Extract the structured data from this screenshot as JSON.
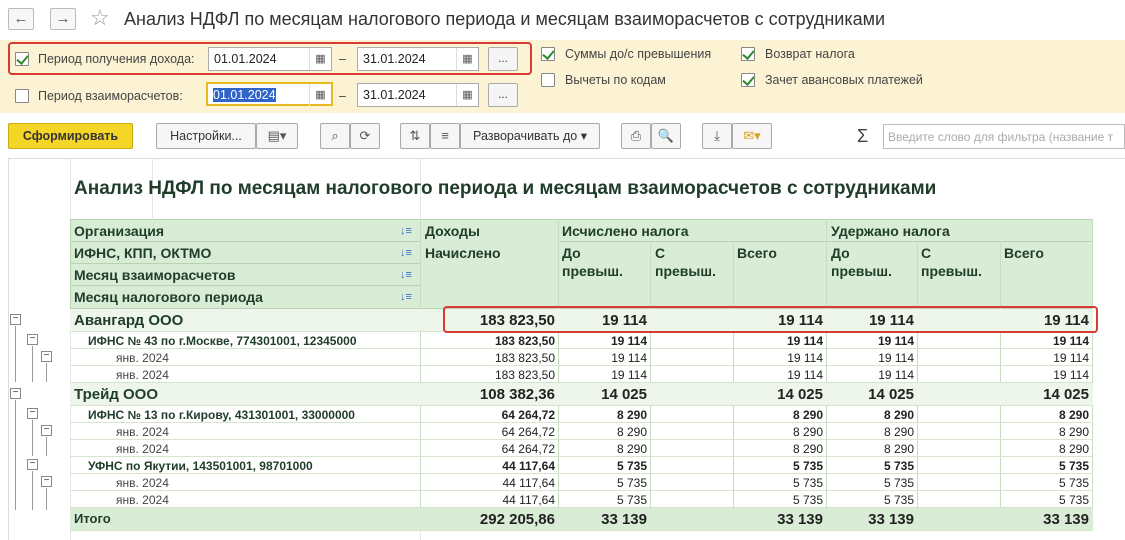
{
  "window": {
    "title": "Анализ НДФЛ по месяцам налогового периода и месяцам взаиморасчетов с сотрудниками"
  },
  "nav": {
    "back": "←",
    "forward": "→",
    "star": "☆"
  },
  "params": {
    "income_period_label": "Период получения дохода:",
    "income_from": "01.01.2024",
    "income_to": "31.01.2024",
    "settle_period_label": "Период взаиморасчетов:",
    "settle_from": "01.01.2024",
    "settle_to": "31.01.2024",
    "dash": "–",
    "dots": "...",
    "opt_sums": "Суммы до/с превышения",
    "opt_deductions": "Вычеты по кодам",
    "opt_refund": "Возврат налога",
    "opt_advance": "Зачет авансовых платежей"
  },
  "toolbar": {
    "generate": "Сформировать",
    "settings": "Настройки...",
    "expand": "Разворачивать до",
    "sigma": "Σ",
    "search_placeholder": "Введите слово для фильтра (название т"
  },
  "report": {
    "title": "Анализ НДФЛ по месяцам налогового периода и месяцам взаиморасчетов с сотрудниками",
    "dims": [
      "Организация",
      "ИФНС, КПП, ОКТМО",
      "Месяц взаиморасчетов",
      "Месяц налогового периода"
    ],
    "headers": {
      "income": "Доходы",
      "accrued": "Начислено",
      "calc": "Исчислено налога",
      "withheld": "Удержано налога",
      "before": "До",
      "before2": "превыш.",
      "after": "С",
      "after2": "превыш.",
      "total": "Всего"
    },
    "rows": [
      {
        "label": "Авангард ООО",
        "v": [
          "183 823,50",
          "19 114",
          "",
          "19 114",
          "19 114",
          "",
          "19 114"
        ]
      },
      {
        "label": "ИФНС № 43 по г.Москве, 774301001, 12345000",
        "v": [
          "183 823,50",
          "19 114",
          "",
          "19 114",
          "19 114",
          "",
          "19 114"
        ]
      },
      {
        "label": "янв. 2024",
        "v": [
          "183 823,50",
          "19 114",
          "",
          "19 114",
          "19 114",
          "",
          "19 114"
        ]
      },
      {
        "label": "янв. 2024",
        "v": [
          "183 823,50",
          "19 114",
          "",
          "19 114",
          "19 114",
          "",
          "19 114"
        ]
      },
      {
        "label": "Трейд ООО",
        "v": [
          "108 382,36",
          "14 025",
          "",
          "14 025",
          "14 025",
          "",
          "14 025"
        ]
      },
      {
        "label": "ИФНС № 13 по г.Кирову, 431301001, 33000000",
        "v": [
          "64 264,72",
          "8 290",
          "",
          "8 290",
          "8 290",
          "",
          "8 290"
        ]
      },
      {
        "label": "янв. 2024",
        "v": [
          "64 264,72",
          "8 290",
          "",
          "8 290",
          "8 290",
          "",
          "8 290"
        ]
      },
      {
        "label": "янв. 2024",
        "v": [
          "64 264,72",
          "8 290",
          "",
          "8 290",
          "8 290",
          "",
          "8 290"
        ]
      },
      {
        "label": "УФНС по Якутии, 143501001, 98701000",
        "v": [
          "44 117,64",
          "5 735",
          "",
          "5 735",
          "5 735",
          "",
          "5 735"
        ]
      },
      {
        "label": "янв. 2024",
        "v": [
          "44 117,64",
          "5 735",
          "",
          "5 735",
          "5 735",
          "",
          "5 735"
        ]
      },
      {
        "label": "янв. 2024",
        "v": [
          "44 117,64",
          "5 735",
          "",
          "5 735",
          "5 735",
          "",
          "5 735"
        ]
      },
      {
        "label": "Итого",
        "v": [
          "292 205,86",
          "33 139",
          "",
          "33 139",
          "33 139",
          "",
          "33 139"
        ]
      }
    ]
  }
}
